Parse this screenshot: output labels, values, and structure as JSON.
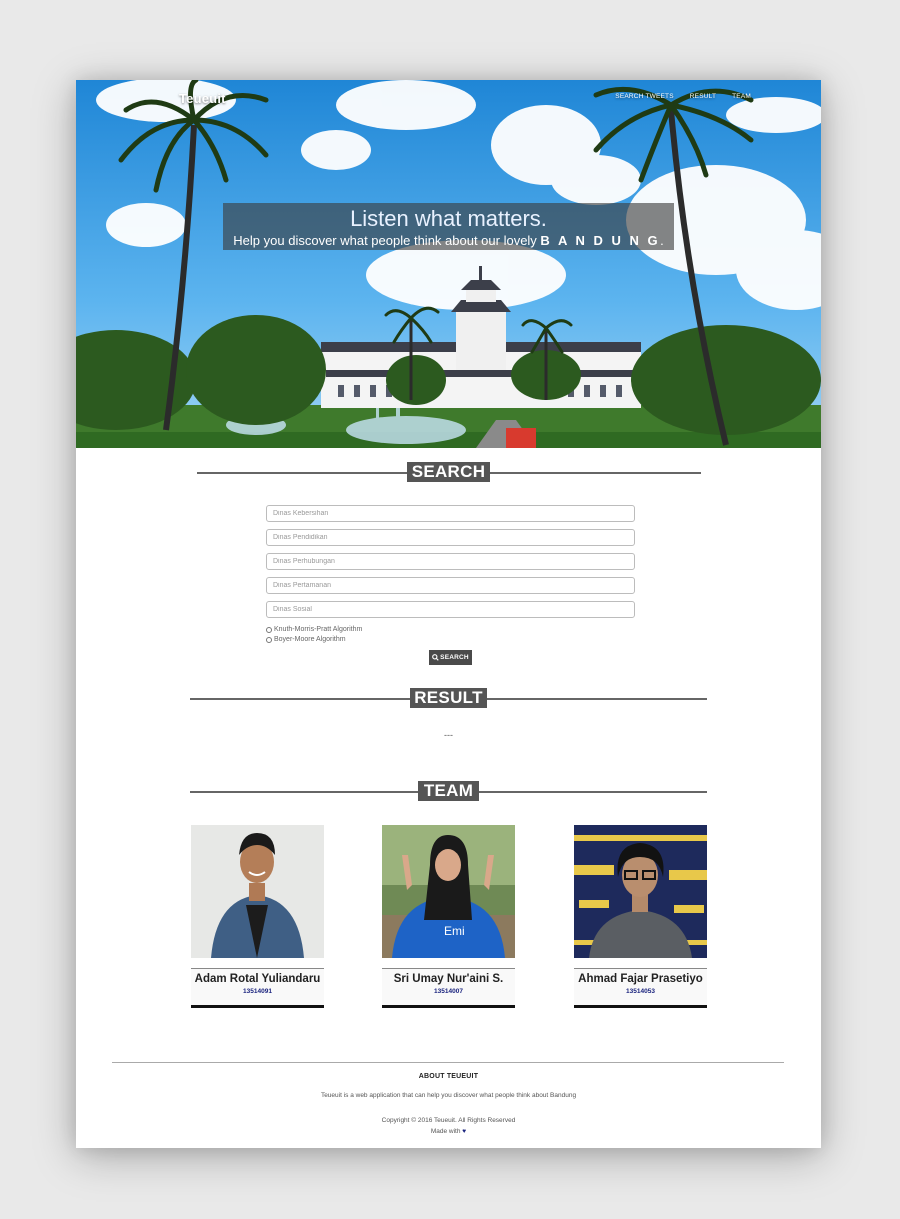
{
  "nav": {
    "brand": "Teueuit",
    "links": [
      "Search Tweets",
      "Result",
      "Team"
    ]
  },
  "hero": {
    "headline": "Listen what matters.",
    "subline_prefix": "Help you discover what people think about our lovely ",
    "subline_city": "B A N D U N G",
    "subline_suffix": "."
  },
  "search": {
    "title": "SEARCH",
    "fields": [
      {
        "placeholder": "Dinas Kebersihan",
        "value": ""
      },
      {
        "placeholder": "Dinas Pendidikan",
        "value": ""
      },
      {
        "placeholder": "Dinas Perhubungan",
        "value": ""
      },
      {
        "placeholder": "Dinas Pertamanan",
        "value": ""
      },
      {
        "placeholder": "Dinas Sosial",
        "value": ""
      }
    ],
    "algorithms": [
      "Knuth-Morris-Pratt Algorithm",
      "Boyer-Moore Algorithm"
    ],
    "button_label": "SEARCH",
    "button_icon": "search-icon"
  },
  "result": {
    "title": "RESULT",
    "text": "---"
  },
  "team": {
    "title": "TEAM",
    "members": [
      {
        "name": "Adam Rotal Yuliandaru",
        "nim": "13514091"
      },
      {
        "name": "Sri Umay Nur'aini S.",
        "nim": "13514007"
      },
      {
        "name": "Ahmad Fajar Prasetiyo",
        "nim": "13514053"
      }
    ]
  },
  "footer": {
    "about_title": "ABOUT TEUEUIT",
    "about_text": "Teueuit is a web application that can help you discover what people think about Bandung",
    "copyright": "Copyright © 2016 Teueuit. All Rights Reserved",
    "made_with": "Made with",
    "heart": "♥"
  },
  "colors": {
    "section_title_bg": "#555555",
    "accent_blue": "#1a237e",
    "page_bg": "#e9e9e9"
  }
}
